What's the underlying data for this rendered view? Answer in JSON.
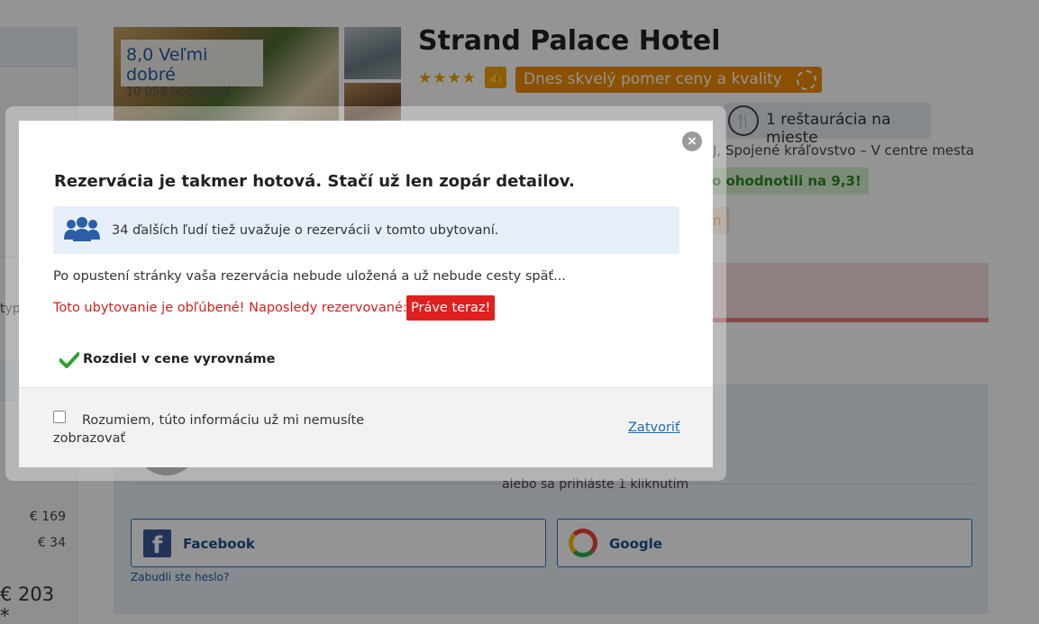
{
  "background": {
    "hotel": {
      "name": "Strand Palace Hotel",
      "rating_score": "8,0 Veľmi dobré",
      "rating_count": "10 058 hodnotení",
      "stars": "★★★★",
      "value_badge": "Dnes skvelý pomer ceny a kvality",
      "amenity_restaurant": "1 reštaurácia na mieste",
      "address": "J, Spojené kráľovstvo – V centre mesta",
      "review_badge": "o ohodnotili na 9,3!",
      "orange_chip": "n"
    },
    "left_panel": {
      "stub": "typ",
      "price_a": "€ 169",
      "price_b": "€ 34",
      "price_total": "€ 203 *"
    },
    "login": {
      "quick_login": "alebo sa prihláste 1 kliknutím",
      "facebook_label": "Facebook",
      "google_label": "Google",
      "forgot_password": "Zabudli ste heslo?"
    }
  },
  "modal": {
    "close_symbol": "×",
    "title": "Rezervácia je takmer hotová. Stačí už len zopár detailov.",
    "info_text": "34 ďalších ľudí tiež uvažuje o rezervácii v tomto ubytovaní.",
    "warning_text": "Po opustení stránky vaša rezervácia nebude uložená a už nebude cesty späť...",
    "popular_text": "Toto ubytovanie je obľúbené! Naposledy rezervované:",
    "now_badge": "Práve teraz!",
    "price_match": "Rozdiel v cene vyrovnáme",
    "dont_show_label": "Rozumiem, túto informáciu už mi nemusíte zobrazovať",
    "dont_show_checked": false,
    "close_link": "Zatvoriť"
  },
  "colors": {
    "accent_blue": "#1f6bb5",
    "value_orange": "#f08a00",
    "alert_red": "#e01f1f",
    "check_green": "#2ea32e"
  }
}
